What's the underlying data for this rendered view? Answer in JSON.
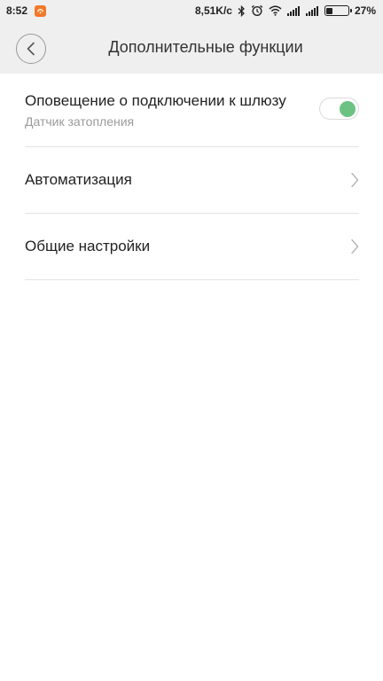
{
  "status_bar": {
    "time": "8:52",
    "network_speed": "8,51K/c",
    "battery_percent": "27%",
    "battery_level": 0.27,
    "icons": [
      "app-notification-icon",
      "bluetooth-icon",
      "alarm-icon",
      "wifi-icon",
      "signal-icon",
      "signal-icon",
      "battery-icon"
    ]
  },
  "header": {
    "title": "Дополнительные функции",
    "back_icon": "chevron-left-icon"
  },
  "settings": {
    "notification": {
      "title": "Оповещение о подключении к шлюзу",
      "subtitle": "Датчик затопления",
      "enabled": true,
      "toggle_color": "#6cc282"
    },
    "automation": {
      "label": "Автоматизация",
      "icon": "chevron-right-icon"
    },
    "general": {
      "label": "Общие настройки",
      "icon": "chevron-right-icon"
    }
  },
  "colors": {
    "header_bg": "#efefef",
    "divider": "#e3e3e3",
    "accent_green": "#6cc282",
    "notification_orange": "#f07a2a"
  }
}
